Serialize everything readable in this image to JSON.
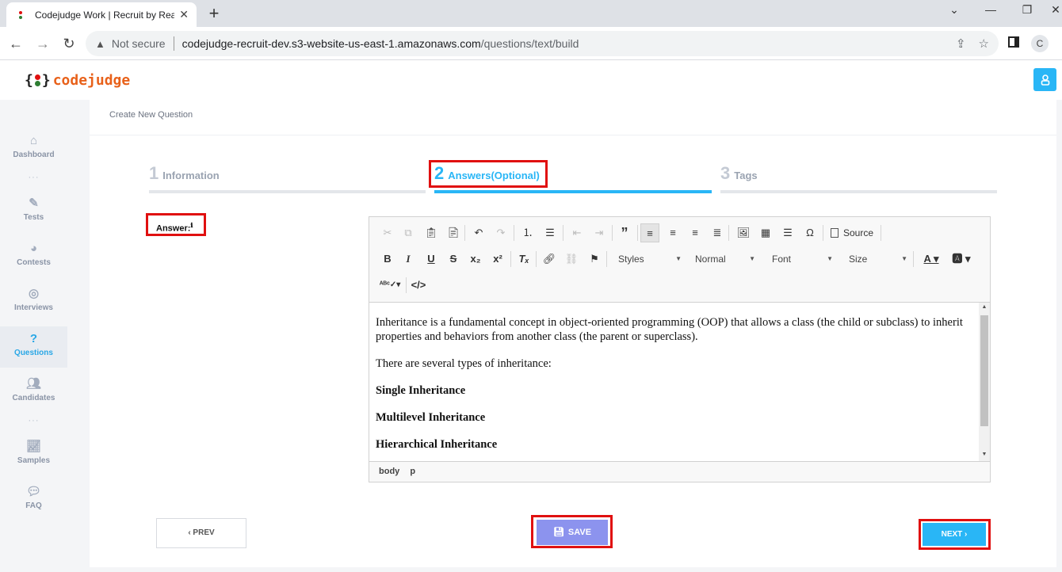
{
  "browser": {
    "tab_title": "Codejudge Work | Recruit by Rea",
    "tab_close": "✕",
    "new_tab": "+",
    "window_controls": [
      "⌄",
      "—",
      "❐",
      "✕"
    ],
    "nav": {
      "back": "←",
      "forward": "→",
      "reload": "↻"
    },
    "security_label": "Not secure",
    "url_host": "codejudge-recruit-dev.s3-website-us-east-1.amazonaws.com",
    "url_path": "/questions/text/build",
    "profile_initial": "C"
  },
  "app": {
    "logo_open": "{",
    "logo_close": "}",
    "logo_word": "codejudge",
    "brand_color": "#e8611a",
    "accent_color": "#29b6f6"
  },
  "sidebar": {
    "items": [
      {
        "label": "Dashboard",
        "icon": "home-icon",
        "active": false
      },
      {
        "label": "Tests",
        "icon": "pencil-icon",
        "active": false
      },
      {
        "label": "Contests",
        "icon": "pie-chart-icon",
        "active": false
      },
      {
        "label": "Interviews",
        "icon": "broadcast-icon",
        "active": false
      },
      {
        "label": "Questions",
        "icon": "question-icon",
        "active": true
      },
      {
        "label": "Candidates",
        "icon": "users-icon",
        "active": false
      },
      {
        "label": "Samples",
        "icon": "line-chart-icon",
        "active": false
      },
      {
        "label": "FAQ",
        "icon": "chat-icon",
        "active": false
      }
    ]
  },
  "breadcrumb": "Create New Question",
  "steps": [
    {
      "num": "1",
      "label": "Information",
      "active": false
    },
    {
      "num": "2",
      "label": "Answers(Optional)",
      "active": true
    },
    {
      "num": "3",
      "label": "Tags",
      "active": false
    }
  ],
  "answer_label": "Answer:",
  "answer_info": "ℹ",
  "editor": {
    "combos": {
      "styles": "Styles",
      "format": "Normal",
      "font": "Font",
      "size": "Size"
    },
    "source_label": "Source",
    "content": {
      "p1": "Inheritance is a fundamental concept in object-oriented programming (OOP) that allows a class (the child or subclass) to inherit properties and behaviors from another class (the parent or superclass).",
      "p2": "There are several types of inheritance:",
      "h1": "Single Inheritance",
      "h2": "Multilevel Inheritance",
      "h3": "Hierarchical Inheritance"
    },
    "path": [
      "body",
      "p"
    ]
  },
  "buttons": {
    "prev": "‹ PREV",
    "save": "SAVE",
    "next": "NEXT ›"
  }
}
